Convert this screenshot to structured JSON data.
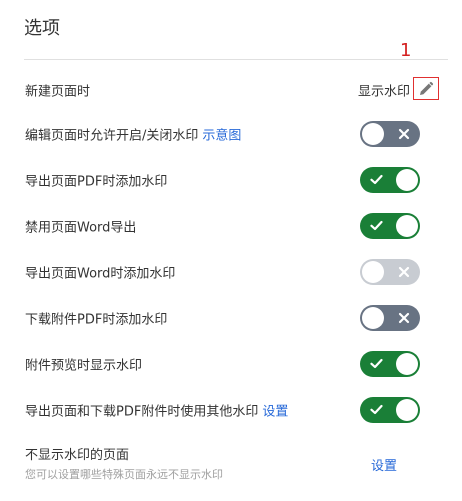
{
  "page": {
    "title": "选项"
  },
  "annotation": {
    "marker": "1"
  },
  "rows": [
    {
      "label": "新建页面时",
      "value": "显示水印",
      "state": "value"
    },
    {
      "label": "编辑页面时允许开启/关闭水印",
      "link": "示意图",
      "state": "off"
    },
    {
      "label": "导出页面PDF时添加水印",
      "state": "on"
    },
    {
      "label": "禁用页面Word导出",
      "state": "on"
    },
    {
      "label": "导出页面Word时添加水印",
      "state": "disabled"
    },
    {
      "label": "下载附件PDF时添加水印",
      "state": "off"
    },
    {
      "label": "附件预览时显示水印",
      "state": "on"
    },
    {
      "label": "导出页面和下载PDF附件时使用其他水印",
      "link": "设置",
      "state": "on"
    }
  ],
  "no_watermark": {
    "label": "不显示水印的页面",
    "hint": "您可以设置哪些特殊页面永远不显示水印",
    "action": "设置"
  },
  "colors": {
    "on": "#1a7f37",
    "off": "#687383",
    "disabled": "#c8ccd2",
    "link": "#2769d8",
    "highlight": "#e03030"
  },
  "icons": {
    "edit": "pencil-icon",
    "check": "check-icon",
    "cross": "close-icon"
  }
}
